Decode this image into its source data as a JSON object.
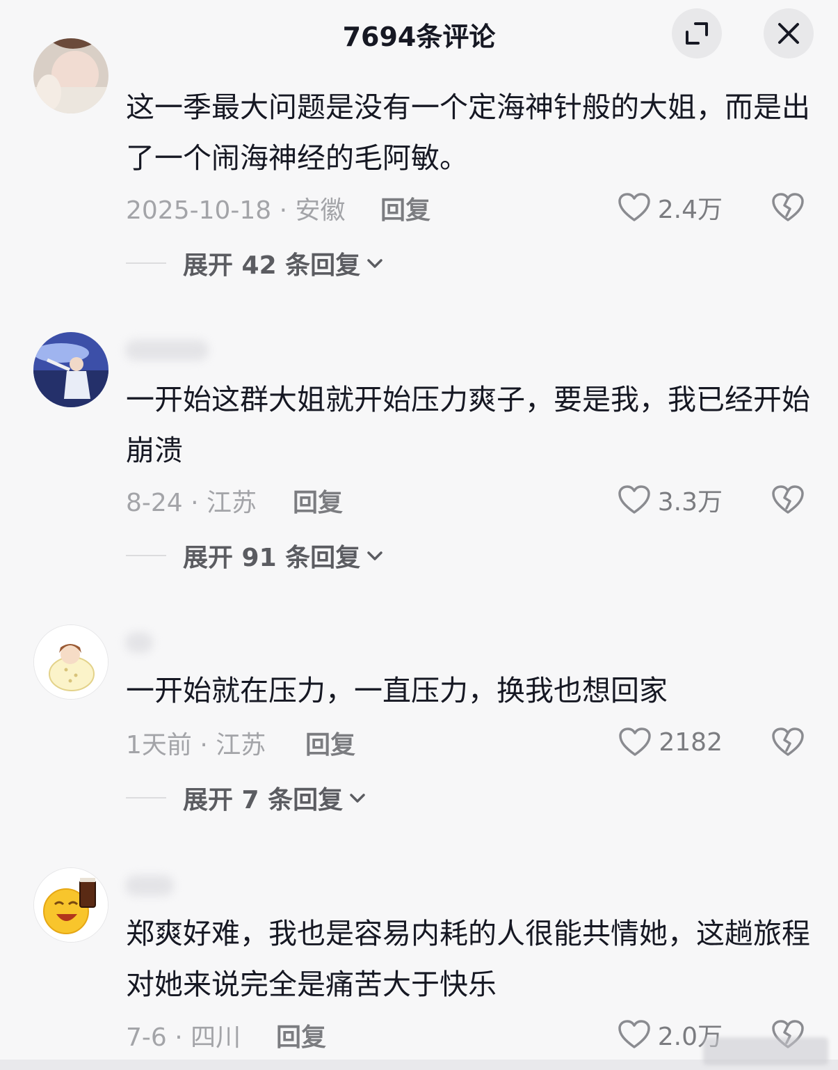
{
  "header": {
    "title": "7694条评论"
  },
  "icons": {
    "expand": "expand-icon",
    "close": "close-icon",
    "like": "heart-icon",
    "dislike": "broken-heart-icon",
    "chevron": "chevron-down-icon"
  },
  "colors": {
    "background": "#f7f7f8",
    "text_primary": "#161823",
    "text_secondary": "#a3a4a8",
    "action_text": "#7b7c80"
  },
  "comments": [
    {
      "text": "这一季最大问题是没有一个定海神针般的大姐，而是出了一个闹海神经的毛阿敏。",
      "date_location": "2025-10-18 · 安徽",
      "reply_label": "回复",
      "likes": "2.4万",
      "expand_label": "展开 42 条回复"
    },
    {
      "text": "一开始这群大姐就开始压力爽子，要是我，我已经开始崩溃",
      "date_location": "8-24 · 江苏",
      "reply_label": "回复",
      "likes": "3.3万",
      "expand_label": "展开 91 条回复"
    },
    {
      "text": "一开始就在压力，一直压力，换我也想回家",
      "date_location": "1天前 · 江苏",
      "reply_label": "回复",
      "likes": "2182",
      "expand_label": "展开 7 条回复"
    },
    {
      "text": "郑爽好难，我也是容易内耗的人很能共情她，这趟旅程对她来说完全是痛苦大于快乐",
      "date_location": "7-6 · 四川",
      "reply_label": "回复",
      "likes": "2.0万"
    }
  ]
}
